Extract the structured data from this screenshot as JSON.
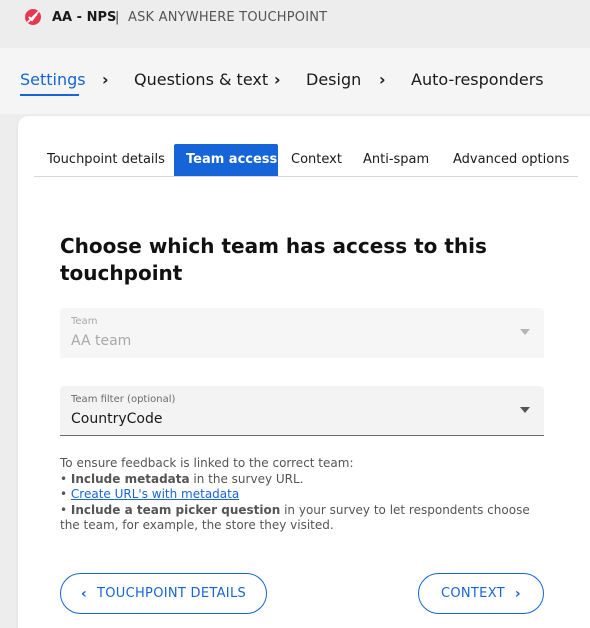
{
  "header": {
    "app_name": "AA - NPS",
    "separator": "|",
    "subtitle": "ASK ANYWHERE TOUCHPOINT",
    "brand_color": "#e53950"
  },
  "wizard": {
    "steps": [
      "Settings",
      "Questions & text",
      "Design",
      "Auto-responders"
    ],
    "active_index": 0,
    "chevron": "›"
  },
  "tabs": {
    "items": [
      "Touchpoint details",
      "Team access",
      "Context",
      "Anti-spam",
      "Advanced options"
    ],
    "active_index": 1
  },
  "main": {
    "heading_parts": [
      "Choose which ",
      "team",
      " has ",
      "access",
      " to this touchpoint"
    ],
    "team_field": {
      "label": "Team",
      "value": "AA team",
      "disabled": true
    },
    "filter_field": {
      "label": "Team filter (optional)",
      "value": "CountryCode"
    },
    "help": {
      "intro": "To ensure feedback is linked to the correct team:",
      "bullet1_bold": "Include metadata",
      "bullet1_rest": " in the survey URL.",
      "link": "Create URL's with metadata",
      "bullet3_bold": "Include a team picker question",
      "bullet3_rest": " in your survey to let respondents choose the team, for example, the store they visited.",
      "bullet": "• "
    }
  },
  "footer": {
    "back_label": "TOUCHPOINT DETAILS",
    "next_label": "CONTEXT",
    "back_arrow": "‹",
    "next_arrow": "›"
  },
  "colors": {
    "accent": "#1565d8"
  }
}
